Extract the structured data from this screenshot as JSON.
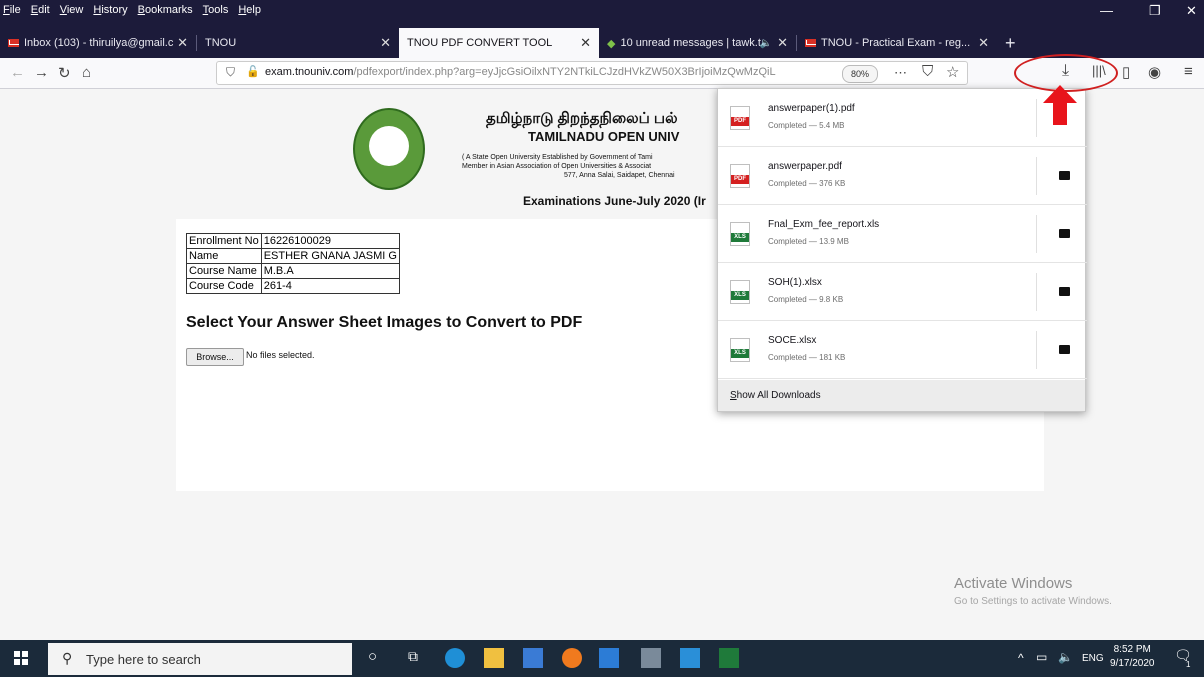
{
  "menubar": {
    "file": "File",
    "edit": "Edit",
    "view": "View",
    "history": "History",
    "bookmarks": "Bookmarks",
    "tools": "Tools",
    "help": "Help"
  },
  "tabs": [
    {
      "label": "Inbox (103) - thiruilya@gmail.c"
    },
    {
      "label": "TNOU"
    },
    {
      "label": "TNOU PDF CONVERT TOOL"
    },
    {
      "label": "10 unread messages | tawk.t"
    },
    {
      "label": "TNOU - Practical Exam - reg..."
    }
  ],
  "url": {
    "domain": "exam.tnouniv.com",
    "path": "/pdfexport/index.php?arg=eyJjcGsiOilxNTY2NTkiLCJzdHVkZW50X3BrIjoiMzQwMzQiL",
    "zoom": "80%"
  },
  "page": {
    "tamil_title": "தமிழ்நாடு திறந்தநிலைப் பல்",
    "english_title": "TAMILNADU OPEN UNIV",
    "sub1": "( A State Open University Established by Government of Tami",
    "sub2": "Member in Asian Association of Open Universities & Associat",
    "sub3": "577, Anna Salai, Saidapet, Chennai",
    "exam_title": "Examinations June-July 2020 (Ir",
    "info": {
      "enroll_label": "Enrollment No",
      "enroll_value": "16226100029",
      "name_label": "Name",
      "name_value": "ESTHER GNANA JASMI G",
      "course_name_label": "Course Name",
      "course_name_value": "M.B.A",
      "course_code_label": "Course Code",
      "course_code_value": "261-4"
    },
    "select_heading": "Select Your Answer Sheet Images to Convert to PDF",
    "browse_label": "Browse...",
    "no_files": "No files selected."
  },
  "downloads": {
    "items": [
      {
        "name": "answerpaper(1).pdf",
        "status": "Completed — 5.4 MB",
        "type": "PDF"
      },
      {
        "name": "answerpaper.pdf",
        "status": "Completed — 376 KB",
        "type": "PDF"
      },
      {
        "name": "Fnal_Exm_fee_report.xls",
        "status": "Completed — 13.9 MB",
        "type": "XLS"
      },
      {
        "name": "SOH(1).xlsx",
        "status": "Completed — 9.8 KB",
        "type": "XLS"
      },
      {
        "name": "SOCE.xlsx",
        "status": "Completed — 181 KB",
        "type": "XLS"
      }
    ],
    "show_all": "Show All Downloads"
  },
  "watermark": {
    "line1": "Activate Windows",
    "line2": "Go to Settings to activate Windows."
  },
  "taskbar": {
    "search_placeholder": "Type here to search",
    "language": "ENG",
    "time": "8:52 PM",
    "date": "9/17/2020",
    "notification_count": "1"
  },
  "colors": {
    "titlebar": "#1c1b3a",
    "taskbar": "#1b2a3a",
    "annotation_red": "#d02020"
  }
}
